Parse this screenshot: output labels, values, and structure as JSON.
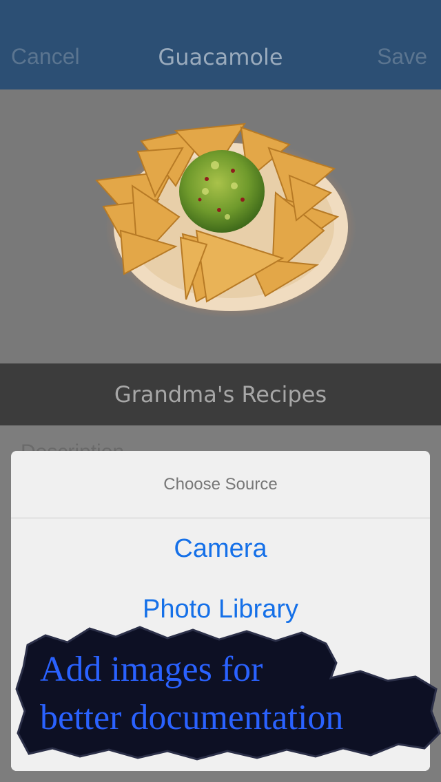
{
  "nav": {
    "cancel_label": "Cancel",
    "title": "Guacamole",
    "save_label": "Save"
  },
  "photo": {
    "subject": "Tortilla chips with guacamole on a plate"
  },
  "book": {
    "name": "Grandma's Recipes"
  },
  "form": {
    "description_label": "Description"
  },
  "action_sheet": {
    "title": "Choose Source",
    "options": [
      "Camera",
      "Photo Library"
    ]
  },
  "promo": {
    "line1": "Add images for",
    "line2": "better documentation"
  },
  "colors": {
    "nav_bar": "#2c4f74",
    "book_bar": "#3c3c3c",
    "option_blue": "#1570e8",
    "promo_text": "#2a62ff"
  }
}
